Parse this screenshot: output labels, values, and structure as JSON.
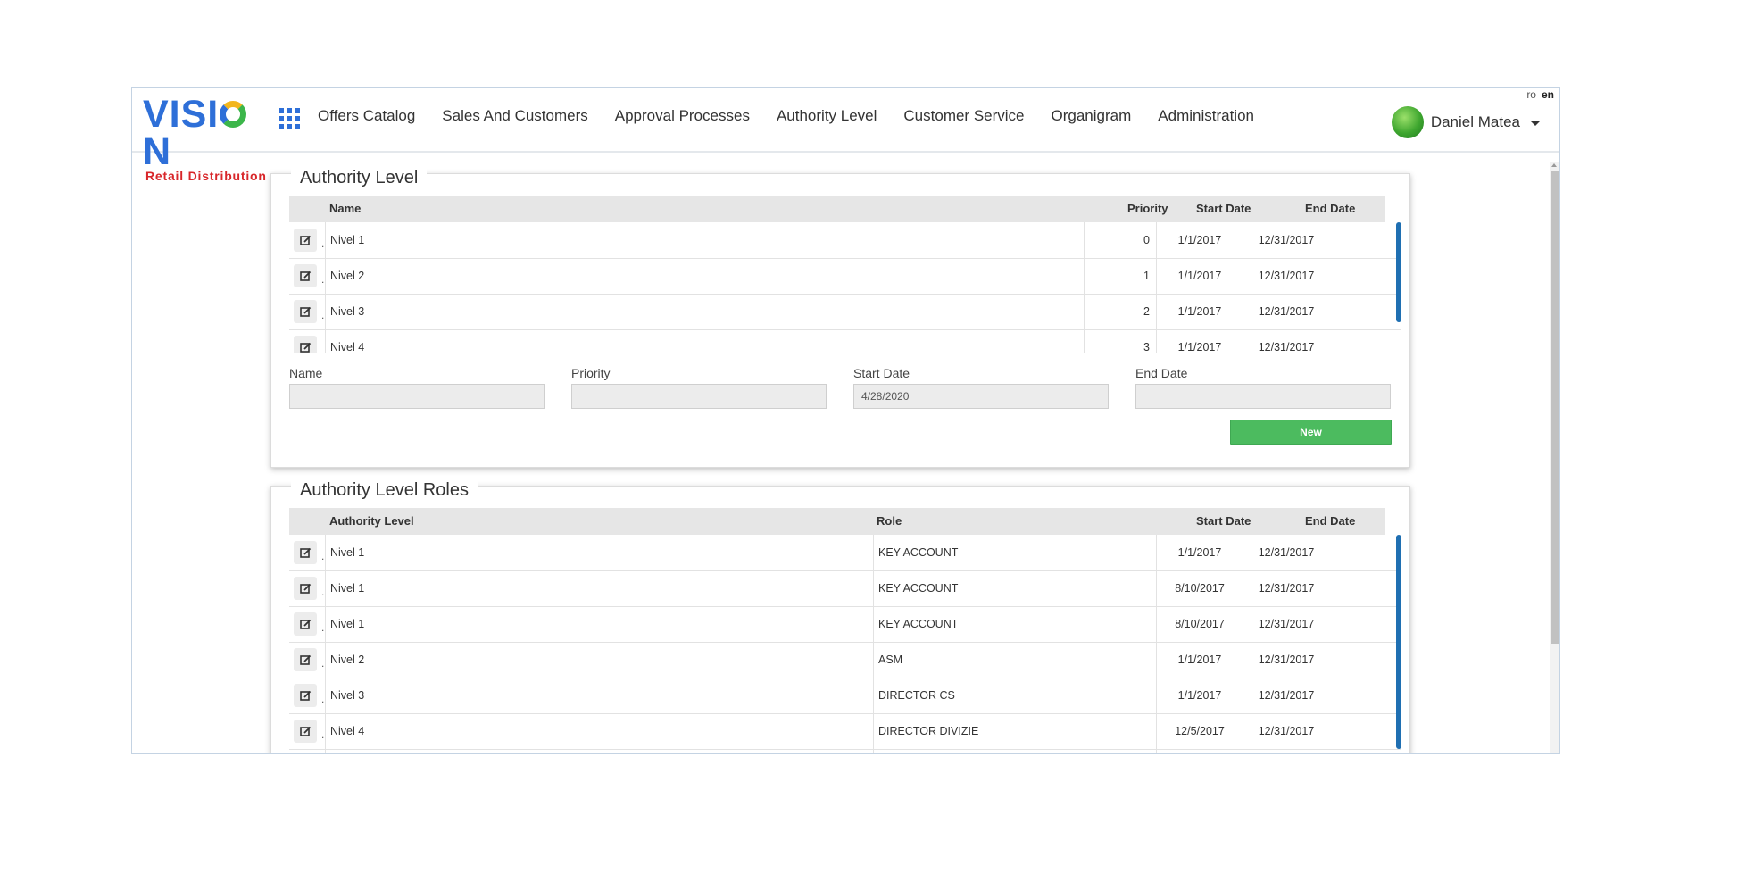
{
  "header": {
    "logo_brand": "VISI",
    "logo_brand_end": "N",
    "logo_tagline": "Retail Distribution",
    "nav": [
      "Offers Catalog",
      "Sales And Customers",
      "Approval Processes",
      "Authority Level",
      "Customer Service",
      "Organigram",
      "Administration"
    ],
    "languages": [
      "ro",
      "en"
    ],
    "active_language": "en",
    "user_name": "Daniel Matea"
  },
  "authority_level": {
    "title": "Authority Level",
    "columns": [
      "Name",
      "Priority",
      "Start Date",
      "End Date"
    ],
    "rows": [
      {
        "name": "Nivel 1",
        "priority": "0",
        "start": "1/1/2017",
        "end": "12/31/2017"
      },
      {
        "name": "Nivel 2",
        "priority": "1",
        "start": "1/1/2017",
        "end": "12/31/2017"
      },
      {
        "name": "Nivel 3",
        "priority": "2",
        "start": "1/1/2017",
        "end": "12/31/2017"
      },
      {
        "name": "Nivel 4",
        "priority": "3",
        "start": "1/1/2017",
        "end": "12/31/2017"
      }
    ],
    "form": {
      "name_label": "Name",
      "name_value": "",
      "priority_label": "Priority",
      "priority_value": "",
      "start_label": "Start Date",
      "start_value": "4/28/2020",
      "end_label": "End Date",
      "end_value": "",
      "new_button": "New"
    }
  },
  "authority_level_roles": {
    "title": "Authority Level Roles",
    "columns": [
      "Authority Level",
      "Role",
      "Start Date",
      "End Date"
    ],
    "rows": [
      {
        "level": "Nivel 1",
        "role": "KEY ACCOUNT",
        "start": "1/1/2017",
        "end": "12/31/2017"
      },
      {
        "level": "Nivel 1",
        "role": "KEY ACCOUNT",
        "start": "8/10/2017",
        "end": "12/31/2017"
      },
      {
        "level": "Nivel 1",
        "role": "KEY ACCOUNT",
        "start": "8/10/2017",
        "end": "12/31/2017"
      },
      {
        "level": "Nivel 2",
        "role": "ASM",
        "start": "1/1/2017",
        "end": "12/31/2017"
      },
      {
        "level": "Nivel 3",
        "role": "DIRECTOR CS",
        "start": "1/1/2017",
        "end": "12/31/2017"
      },
      {
        "level": "Nivel 4",
        "role": "DIRECTOR DIVIZIE",
        "start": "12/5/2017",
        "end": "12/31/2017"
      }
    ]
  },
  "colors": {
    "brand_blue": "#2e6fd8",
    "tagline_red": "#d8262a",
    "new_button_green": "#4cbb5f",
    "scroll_accent": "#1f6fb2"
  },
  "icons": {
    "apps": "grid-icon",
    "edit": "edit-icon",
    "user_caret": "caret-down-icon"
  }
}
